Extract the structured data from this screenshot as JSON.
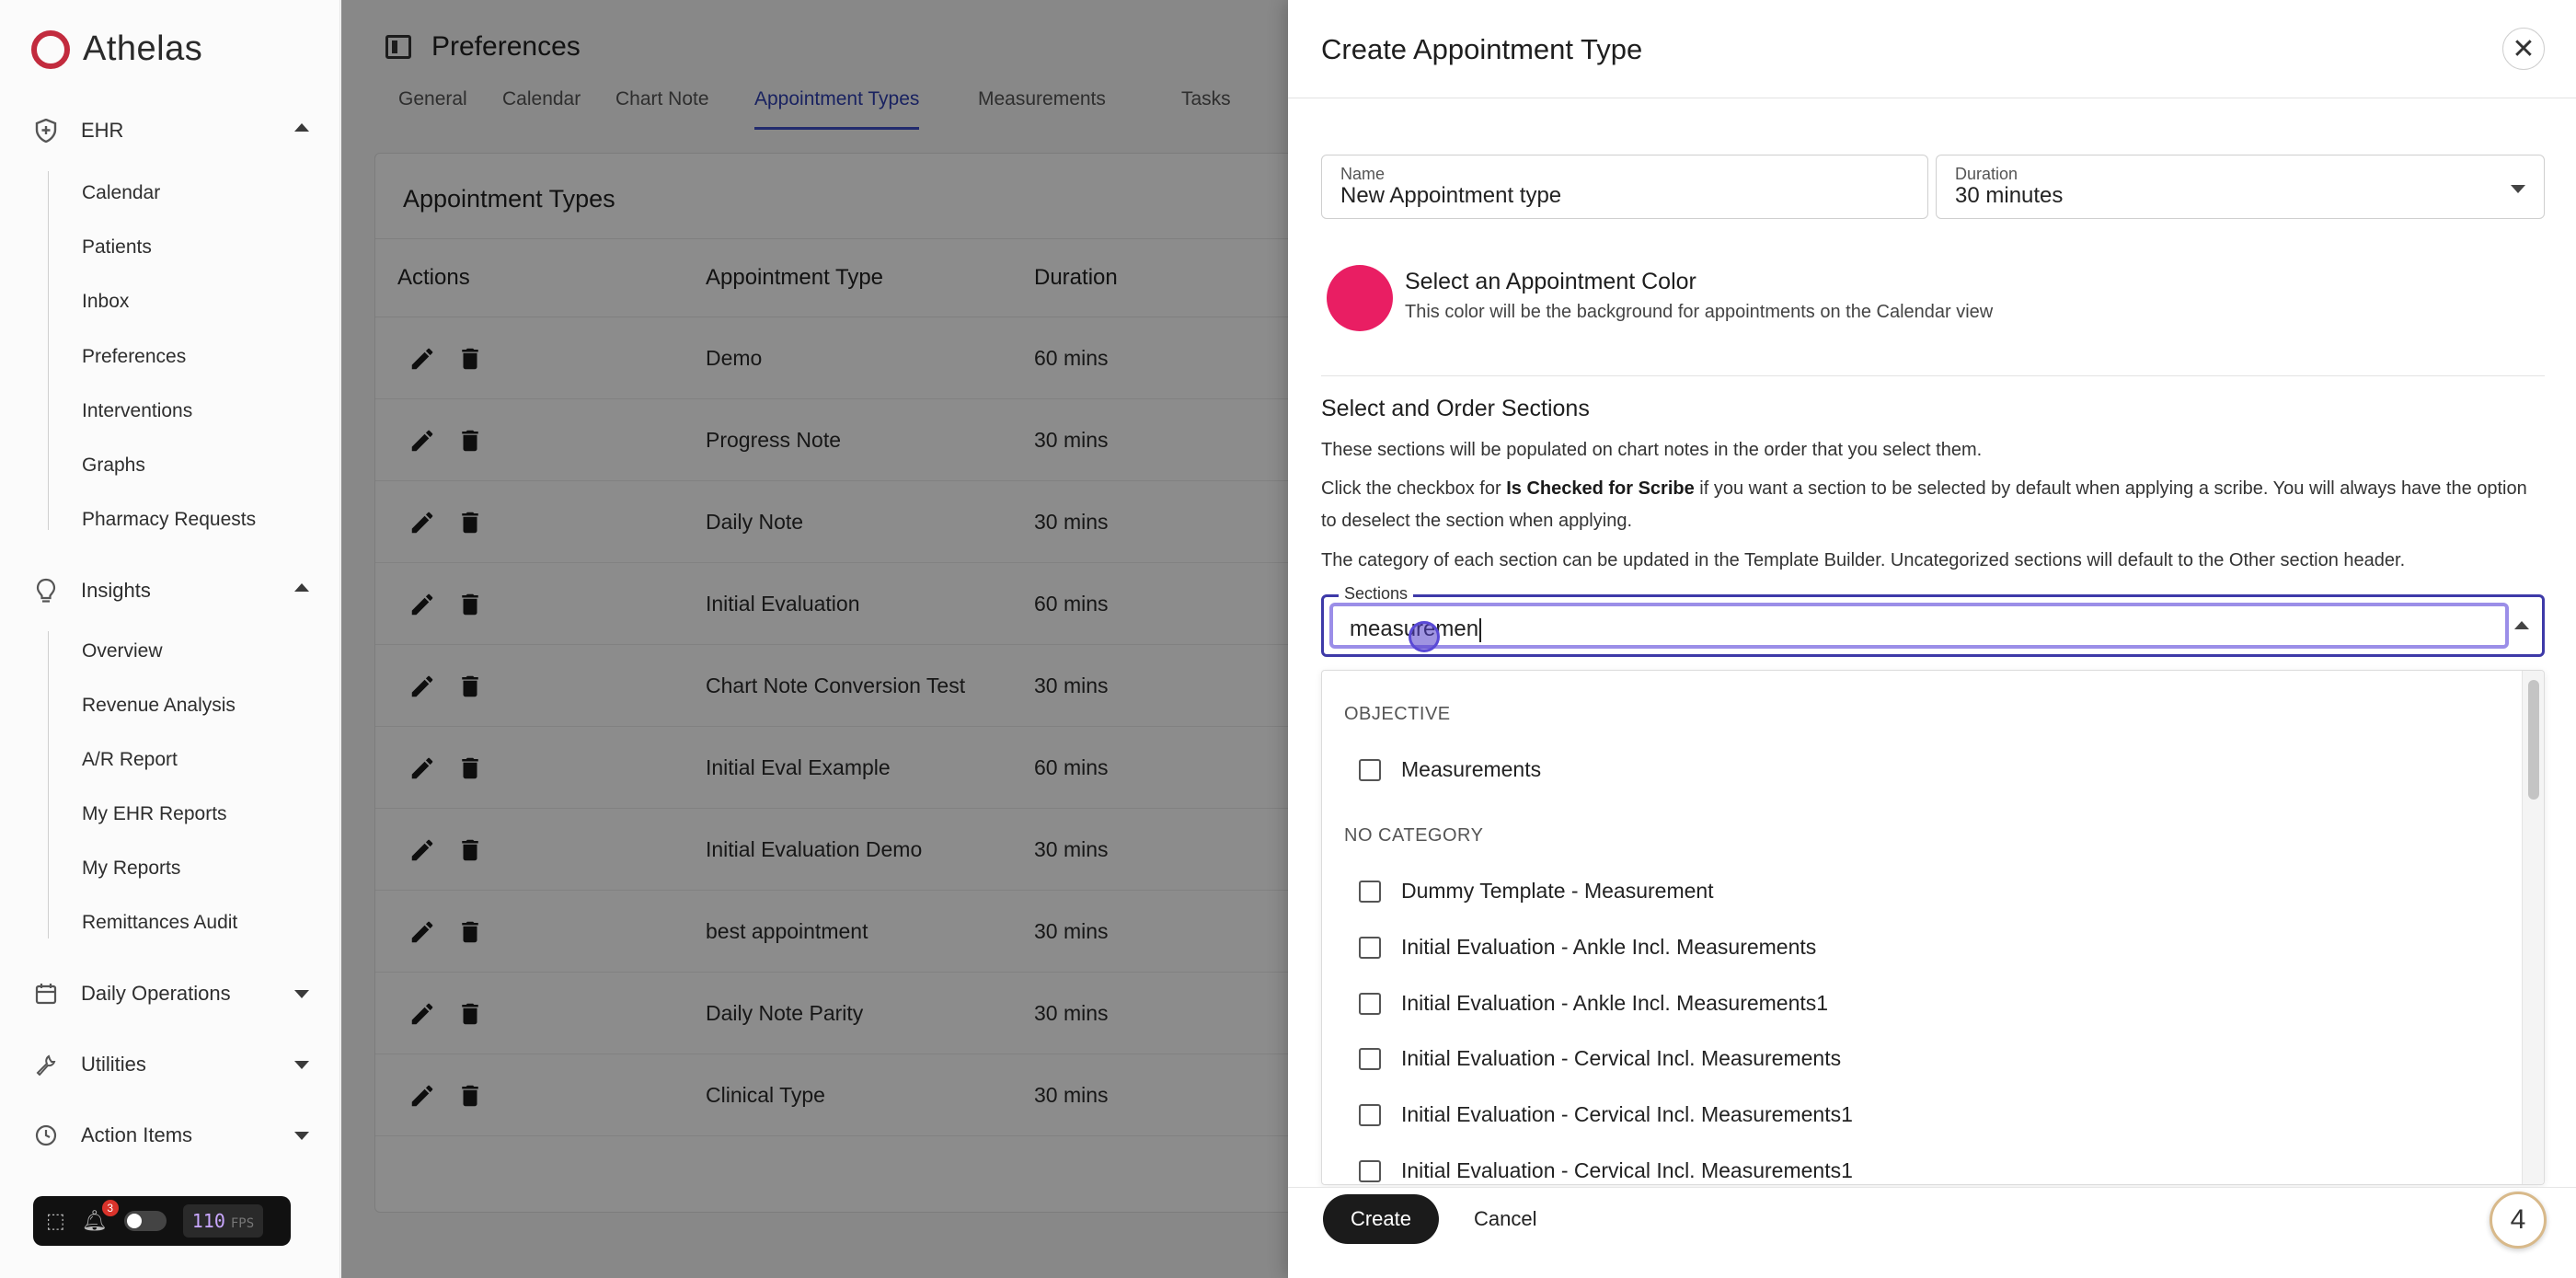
{
  "app": {
    "name": "Athelas"
  },
  "sidebar": {
    "groups": [
      {
        "label": "EHR",
        "icon": "shield-icon",
        "expanded": true,
        "items": [
          "Calendar",
          "Patients",
          "Inbox",
          "Preferences",
          "Interventions",
          "Graphs",
          "Pharmacy Requests"
        ]
      },
      {
        "label": "Insights",
        "icon": "lightbulb-icon",
        "expanded": true,
        "items": [
          "Overview",
          "Revenue Analysis",
          "A/R Report",
          "My EHR Reports",
          "My Reports",
          "Remittances Audit"
        ]
      },
      {
        "label": "Daily Operations",
        "icon": "calendar-icon",
        "expanded": false,
        "items": []
      },
      {
        "label": "Utilities",
        "icon": "wrench-icon",
        "expanded": false,
        "items": []
      },
      {
        "label": "Action Items",
        "icon": "clock-icon",
        "expanded": false,
        "items": []
      }
    ]
  },
  "devbar": {
    "notifications": "3",
    "fps": "110",
    "fps_unit": "FPS"
  },
  "page": {
    "title": "Preferences",
    "tabs": [
      "General",
      "Calendar",
      "Chart Note",
      "Appointment Types",
      "Measurements",
      "Tasks"
    ],
    "active_tab": "Appointment Types"
  },
  "table": {
    "title": "Appointment Types",
    "columns": [
      "Actions",
      "Appointment Type",
      "Duration"
    ],
    "rows": [
      {
        "type": "Demo",
        "duration": "60 mins"
      },
      {
        "type": "Progress Note",
        "duration": "30 mins"
      },
      {
        "type": "Daily Note",
        "duration": "30 mins"
      },
      {
        "type": "Initial Evaluation",
        "duration": "60 mins"
      },
      {
        "type": "Chart Note Conversion Test",
        "duration": "30 mins"
      },
      {
        "type": "Initial Eval Example",
        "duration": "60 mins"
      },
      {
        "type": "Initial Evaluation Demo",
        "duration": "30 mins"
      },
      {
        "type": "best appointment",
        "duration": "30 mins"
      },
      {
        "type": "Daily Note Parity",
        "duration": "30 mins"
      },
      {
        "type": "Clinical Type",
        "duration": "30 mins"
      }
    ]
  },
  "drawer": {
    "title": "Create Appointment Type",
    "name_label": "Name",
    "name_value": "New Appointment type",
    "duration_label": "Duration",
    "duration_value": "30 minutes",
    "color_title": "Select an Appointment Color",
    "color_sub": "This color will be the background for appointments on the Calendar view",
    "color_value": "#e91e63",
    "sections_title": "Select and Order Sections",
    "para1": "These sections will be populated on chart notes in the order that you select them.",
    "para2_pre": "Click the checkbox for ",
    "para2_bold": "Is Checked for Scribe",
    "para2_post": " if you want a section to be selected by default when applying a scribe. You will always have the option to deselect the section when applying.",
    "para3": "The category of each section can be updated in the Template Builder. Uncategorized sections will default to the Other section header.",
    "sections_label": "Sections",
    "sections_query": "measuremen",
    "categories": [
      {
        "name": "OBJECTIVE",
        "options": [
          "Measurements"
        ]
      },
      {
        "name": "NO CATEGORY",
        "options": [
          "Dummy Template - Measurement",
          "Initial Evaluation - Ankle Incl. Measurements",
          "Initial Evaluation - Ankle Incl. Measurements1",
          "Initial Evaluation - Cervical Incl. Measurements",
          "Initial Evaluation - Cervical Incl. Measurements1",
          "Initial Evaluation - Cervical Incl. Measurements1"
        ]
      }
    ],
    "create_label": "Create",
    "cancel_label": "Cancel",
    "help_count": "4"
  }
}
